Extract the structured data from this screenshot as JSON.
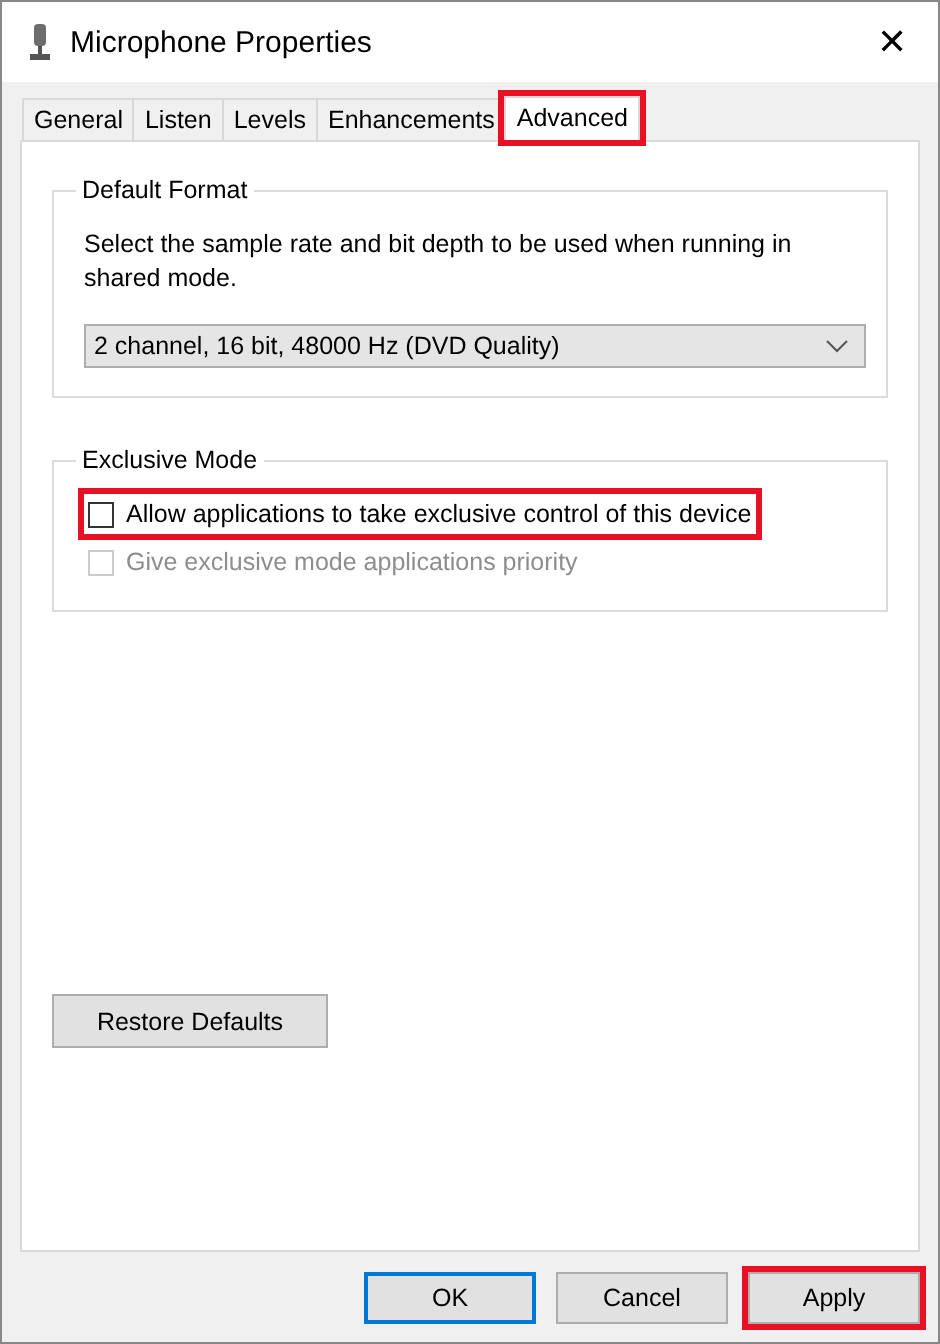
{
  "window": {
    "title": "Microphone Properties",
    "close": "✕"
  },
  "tabs": [
    {
      "label": "General",
      "selected": false,
      "highlighted": false
    },
    {
      "label": "Listen",
      "selected": false,
      "highlighted": false
    },
    {
      "label": "Levels",
      "selected": false,
      "highlighted": false
    },
    {
      "label": "Enhancements",
      "selected": false,
      "highlighted": false
    },
    {
      "label": "Advanced",
      "selected": true,
      "highlighted": true
    }
  ],
  "default_format": {
    "title": "Default Format",
    "description": "Select the sample rate and bit depth to be used when running in shared mode.",
    "format": "2 channel, 16 bit, 48000 Hz (DVD Quality)"
  },
  "exclusive_mode": {
    "title": "Exclusive Mode",
    "options": [
      {
        "label": "Allow applications to take exclusive control of this device",
        "checked": false,
        "disabled": false,
        "highlighted": true
      },
      {
        "label": "Give exclusive mode applications priority",
        "checked": false,
        "disabled": true,
        "highlighted": false
      }
    ]
  },
  "restore_button": "Restore Defaults",
  "buttons": [
    {
      "label": "OK",
      "kind": "default",
      "highlighted": false
    },
    {
      "label": "Cancel",
      "kind": "normal",
      "highlighted": false
    },
    {
      "label": "Apply",
      "kind": "normal",
      "highlighted": true
    }
  ]
}
